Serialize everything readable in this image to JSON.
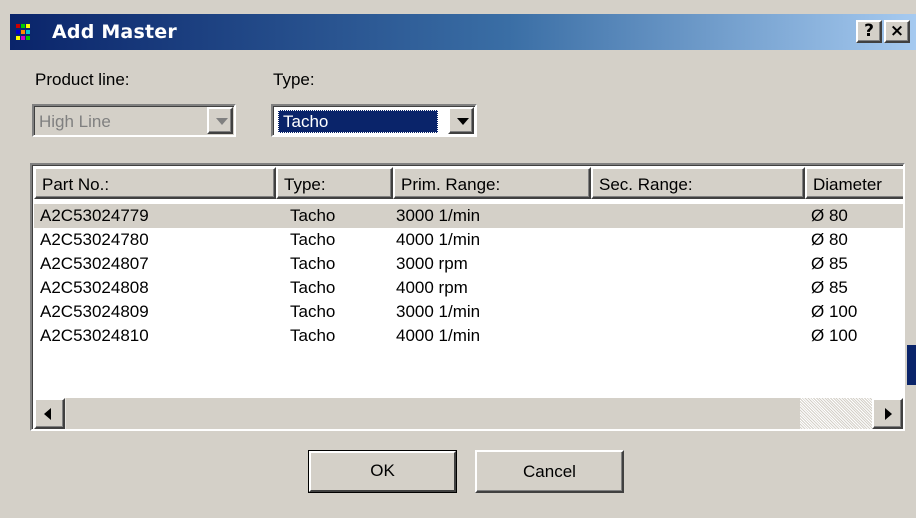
{
  "window": {
    "title": "Add Master",
    "help_label": "?",
    "close_label": "×"
  },
  "form": {
    "product_line_label": "Product line:",
    "product_line_value": "High Line",
    "type_label": "Type:",
    "type_value": "Tacho"
  },
  "table": {
    "columns": [
      "Part No.:",
      "Type:",
      "Prim. Range:",
      "Sec. Range:",
      "Diameter"
    ],
    "rows": [
      [
        "A2C53024779",
        "Tacho",
        "3000 1/min",
        "",
        "Ø 80"
      ],
      [
        "A2C53024780",
        "Tacho",
        "4000 1/min",
        "",
        "Ø 80"
      ],
      [
        "A2C53024807",
        "Tacho",
        "3000 rpm",
        "",
        "Ø 85"
      ],
      [
        "A2C53024808",
        "Tacho",
        "4000 rpm",
        "",
        "Ø 85"
      ],
      [
        "A2C53024809",
        "Tacho",
        "3000 1/min",
        "",
        "Ø 100"
      ],
      [
        "A2C53024810",
        "Tacho",
        "4000 1/min",
        "",
        "Ø 100"
      ]
    ],
    "selected_row": 0
  },
  "buttons": {
    "ok_label": "OK",
    "cancel_label": "Cancel"
  },
  "colors": {
    "title_start": "#0a246a",
    "title_end": "#a6caf0",
    "face": "#d4d0c8",
    "selection": "#0a246a"
  },
  "icons": [
    "app-icon",
    "help-icon",
    "close-icon",
    "dropdown-arrow-icon",
    "scroll-left-icon",
    "scroll-right-icon"
  ]
}
